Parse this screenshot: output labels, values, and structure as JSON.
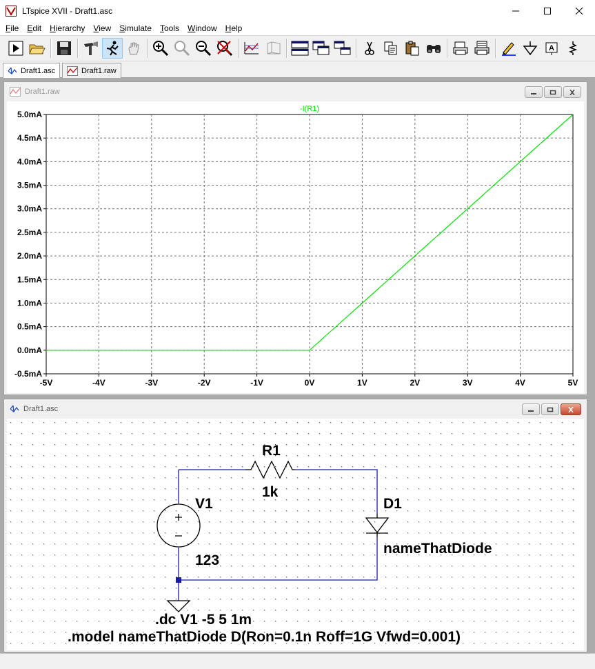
{
  "window": {
    "title": "LTspice XVII - Draft1.asc"
  },
  "menu": [
    {
      "accel": "F",
      "rest": "ile"
    },
    {
      "accel": "E",
      "rest": "dit"
    },
    {
      "accel": "H",
      "rest": "ierarchy"
    },
    {
      "accel": "V",
      "rest": "iew"
    },
    {
      "accel": "S",
      "rest": "imulate"
    },
    {
      "accel": "T",
      "rest": "ools"
    },
    {
      "accel": "W",
      "rest": "indow"
    },
    {
      "accel": "H",
      "rest": "elp"
    }
  ],
  "toolbar": {
    "icons": [
      "run-icon",
      "open-folder-icon",
      "save-icon",
      "hammer-icon",
      "running-man-icon",
      "hand-pan-icon",
      "zoom-in-icon",
      "zoom-fit-icon",
      "zoom-out-icon",
      "zoom-cancel-icon",
      "autorange-icon",
      "autorange-3d-icon",
      "tile-horizontal-icon",
      "cascade-icon",
      "tile-vertical-icon",
      "cut-icon",
      "copy-icon",
      "paste-icon",
      "find-icon",
      "print-setup-icon",
      "print-icon",
      "pencil-icon",
      "ground-icon",
      "label-net-icon",
      "resistor-icon"
    ]
  },
  "tabs": [
    {
      "label": "Draft1.asc",
      "active": true
    },
    {
      "label": "Draft1.raw",
      "active": false
    }
  ],
  "plot_window": {
    "title": "Draft1.raw"
  },
  "schematic_window": {
    "title": "Draft1.asc"
  },
  "chart_data": {
    "type": "line",
    "series": [
      {
        "name": "-I(R1)",
        "color": "#00e000",
        "x": [
          -5,
          0,
          5
        ],
        "y": [
          0.0,
          0.0,
          5.0
        ]
      }
    ],
    "x_ticks": [
      "-5V",
      "-4V",
      "-3V",
      "-2V",
      "-1V",
      "0V",
      "1V",
      "2V",
      "3V",
      "4V",
      "5V"
    ],
    "y_ticks": [
      "5.0mA",
      "4.5mA",
      "4.0mA",
      "3.5mA",
      "3.0mA",
      "2.5mA",
      "2.0mA",
      "1.5mA",
      "1.0mA",
      "0.5mA",
      "0.0mA",
      "-0.5mA"
    ],
    "xlim": [
      -5,
      5
    ],
    "ylim": [
      -0.5,
      5.0
    ],
    "grid": true
  },
  "schematic": {
    "r1_name": "R1",
    "r1_value": "1k",
    "v1_name": "V1",
    "v1_value": "123",
    "d1_name": "D1",
    "d1_model": "nameThatDiode",
    "directive_dc": ".dc V1 -5 5 1m",
    "directive_model": ".model nameThatDiode D(Ron=0.1n Roff=1G Vfwd=0.001)",
    "wire_color": "#1a1aa0"
  }
}
